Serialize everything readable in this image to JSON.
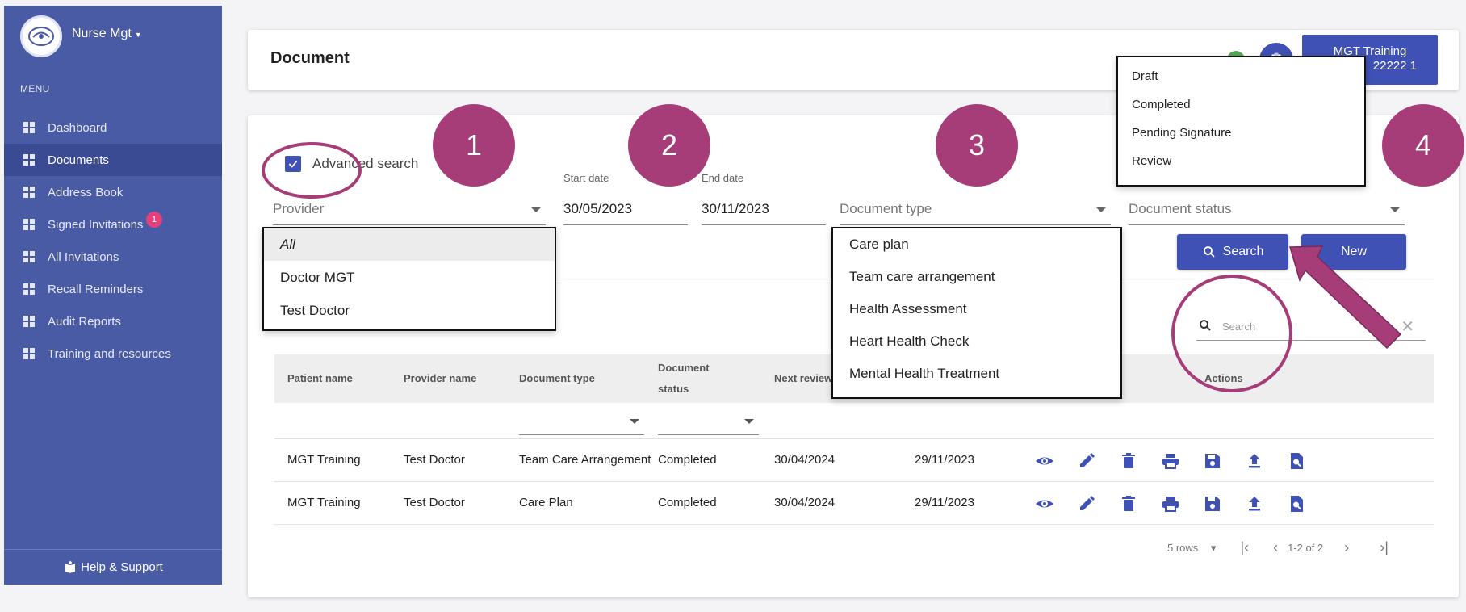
{
  "sidebar": {
    "brand": "Nurse Mgt",
    "menu_label": "MENU",
    "items": [
      {
        "label": "Dashboard"
      },
      {
        "label": "Documents"
      },
      {
        "label": "Address Book"
      },
      {
        "label": "Signed Invitations",
        "badge": "1"
      },
      {
        "label": "All Invitations"
      },
      {
        "label": "Recall Reminders"
      },
      {
        "label": "Audit Reports"
      },
      {
        "label": "Training and resources"
      }
    ],
    "help": "Help & Support",
    "active_index": 1
  },
  "header": {
    "title": "Document",
    "user_line1": "MGT Training",
    "user_line2": "22222 1"
  },
  "filters": {
    "advanced_search": "Advanced search",
    "advanced_checked": true,
    "provider_placeholder": "Provider",
    "start_date_label": "Start date",
    "start_date": "30/05/2023",
    "end_date_label": "End date",
    "end_date": "30/11/2023",
    "doc_type_placeholder": "Document type",
    "doc_status_placeholder": "Document status",
    "search_button": "Search",
    "new_button": "New"
  },
  "provider_options": [
    "All",
    "Doctor MGT",
    "Test Doctor"
  ],
  "doctype_options": [
    "Care plan",
    "Team care arrangement",
    "Health Assessment",
    "Heart Health Check",
    "Mental Health Treatment"
  ],
  "status_options": [
    "Draft",
    "Completed",
    "Pending Signature",
    "Review"
  ],
  "table": {
    "search_placeholder": "Search",
    "columns": [
      "Patient name",
      "Provider name",
      "Document type",
      "Document",
      "status",
      "Next review",
      "Actions"
    ],
    "rows": [
      {
        "patient": "MGT Training",
        "provider": "Test Doctor",
        "type": "Team Care Arrangement",
        "status": "Completed",
        "next_review": "30/04/2024",
        "date": "29/11/2023"
      },
      {
        "patient": "MGT Training",
        "provider": "Test Doctor",
        "type": "Care Plan",
        "status": "Completed",
        "next_review": "30/04/2024",
        "date": "29/11/2023"
      }
    ],
    "rows_per_page": "5 rows",
    "range": "1-2 of 2"
  },
  "annotations": [
    "1",
    "2",
    "3",
    "4"
  ],
  "colors": {
    "sidebar": "#4a5ba6",
    "primary": "#3f51b5",
    "annotation": "#a73d78",
    "badge": "#e4407c"
  }
}
